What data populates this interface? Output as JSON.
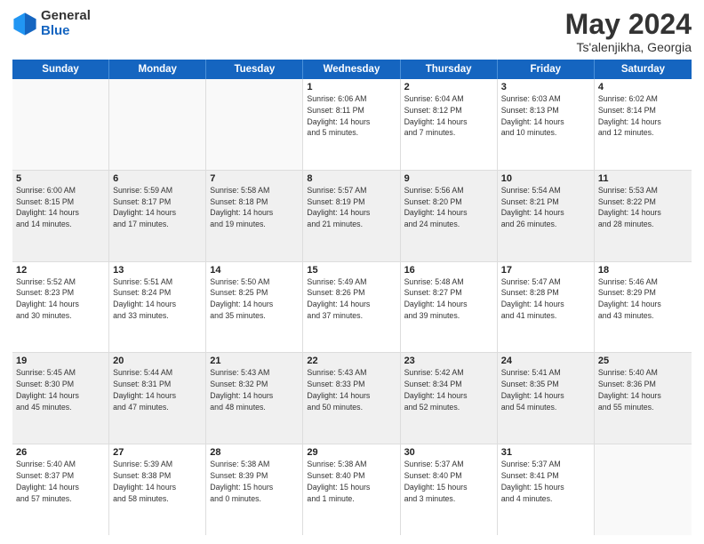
{
  "header": {
    "logo_general": "General",
    "logo_blue": "Blue",
    "title": "May 2024",
    "location": "Ts'alenjikha, Georgia"
  },
  "weekdays": [
    "Sunday",
    "Monday",
    "Tuesday",
    "Wednesday",
    "Thursday",
    "Friday",
    "Saturday"
  ],
  "rows": [
    [
      {
        "day": "",
        "info": "",
        "empty": true
      },
      {
        "day": "",
        "info": "",
        "empty": true
      },
      {
        "day": "",
        "info": "",
        "empty": true
      },
      {
        "day": "1",
        "info": "Sunrise: 6:06 AM\nSunset: 8:11 PM\nDaylight: 14 hours\nand 5 minutes."
      },
      {
        "day": "2",
        "info": "Sunrise: 6:04 AM\nSunset: 8:12 PM\nDaylight: 14 hours\nand 7 minutes."
      },
      {
        "day": "3",
        "info": "Sunrise: 6:03 AM\nSunset: 8:13 PM\nDaylight: 14 hours\nand 10 minutes."
      },
      {
        "day": "4",
        "info": "Sunrise: 6:02 AM\nSunset: 8:14 PM\nDaylight: 14 hours\nand 12 minutes."
      }
    ],
    [
      {
        "day": "5",
        "info": "Sunrise: 6:00 AM\nSunset: 8:15 PM\nDaylight: 14 hours\nand 14 minutes."
      },
      {
        "day": "6",
        "info": "Sunrise: 5:59 AM\nSunset: 8:17 PM\nDaylight: 14 hours\nand 17 minutes."
      },
      {
        "day": "7",
        "info": "Sunrise: 5:58 AM\nSunset: 8:18 PM\nDaylight: 14 hours\nand 19 minutes."
      },
      {
        "day": "8",
        "info": "Sunrise: 5:57 AM\nSunset: 8:19 PM\nDaylight: 14 hours\nand 21 minutes."
      },
      {
        "day": "9",
        "info": "Sunrise: 5:56 AM\nSunset: 8:20 PM\nDaylight: 14 hours\nand 24 minutes."
      },
      {
        "day": "10",
        "info": "Sunrise: 5:54 AM\nSunset: 8:21 PM\nDaylight: 14 hours\nand 26 minutes."
      },
      {
        "day": "11",
        "info": "Sunrise: 5:53 AM\nSunset: 8:22 PM\nDaylight: 14 hours\nand 28 minutes."
      }
    ],
    [
      {
        "day": "12",
        "info": "Sunrise: 5:52 AM\nSunset: 8:23 PM\nDaylight: 14 hours\nand 30 minutes."
      },
      {
        "day": "13",
        "info": "Sunrise: 5:51 AM\nSunset: 8:24 PM\nDaylight: 14 hours\nand 33 minutes."
      },
      {
        "day": "14",
        "info": "Sunrise: 5:50 AM\nSunset: 8:25 PM\nDaylight: 14 hours\nand 35 minutes."
      },
      {
        "day": "15",
        "info": "Sunrise: 5:49 AM\nSunset: 8:26 PM\nDaylight: 14 hours\nand 37 minutes."
      },
      {
        "day": "16",
        "info": "Sunrise: 5:48 AM\nSunset: 8:27 PM\nDaylight: 14 hours\nand 39 minutes."
      },
      {
        "day": "17",
        "info": "Sunrise: 5:47 AM\nSunset: 8:28 PM\nDaylight: 14 hours\nand 41 minutes."
      },
      {
        "day": "18",
        "info": "Sunrise: 5:46 AM\nSunset: 8:29 PM\nDaylight: 14 hours\nand 43 minutes."
      }
    ],
    [
      {
        "day": "19",
        "info": "Sunrise: 5:45 AM\nSunset: 8:30 PM\nDaylight: 14 hours\nand 45 minutes."
      },
      {
        "day": "20",
        "info": "Sunrise: 5:44 AM\nSunset: 8:31 PM\nDaylight: 14 hours\nand 47 minutes."
      },
      {
        "day": "21",
        "info": "Sunrise: 5:43 AM\nSunset: 8:32 PM\nDaylight: 14 hours\nand 48 minutes."
      },
      {
        "day": "22",
        "info": "Sunrise: 5:43 AM\nSunset: 8:33 PM\nDaylight: 14 hours\nand 50 minutes."
      },
      {
        "day": "23",
        "info": "Sunrise: 5:42 AM\nSunset: 8:34 PM\nDaylight: 14 hours\nand 52 minutes."
      },
      {
        "day": "24",
        "info": "Sunrise: 5:41 AM\nSunset: 8:35 PM\nDaylight: 14 hours\nand 54 minutes."
      },
      {
        "day": "25",
        "info": "Sunrise: 5:40 AM\nSunset: 8:36 PM\nDaylight: 14 hours\nand 55 minutes."
      }
    ],
    [
      {
        "day": "26",
        "info": "Sunrise: 5:40 AM\nSunset: 8:37 PM\nDaylight: 14 hours\nand 57 minutes."
      },
      {
        "day": "27",
        "info": "Sunrise: 5:39 AM\nSunset: 8:38 PM\nDaylight: 14 hours\nand 58 minutes."
      },
      {
        "day": "28",
        "info": "Sunrise: 5:38 AM\nSunset: 8:39 PM\nDaylight: 15 hours\nand 0 minutes."
      },
      {
        "day": "29",
        "info": "Sunrise: 5:38 AM\nSunset: 8:40 PM\nDaylight: 15 hours\nand 1 minute."
      },
      {
        "day": "30",
        "info": "Sunrise: 5:37 AM\nSunset: 8:40 PM\nDaylight: 15 hours\nand 3 minutes."
      },
      {
        "day": "31",
        "info": "Sunrise: 5:37 AM\nSunset: 8:41 PM\nDaylight: 15 hours\nand 4 minutes."
      },
      {
        "day": "",
        "info": "",
        "empty": true
      }
    ]
  ]
}
